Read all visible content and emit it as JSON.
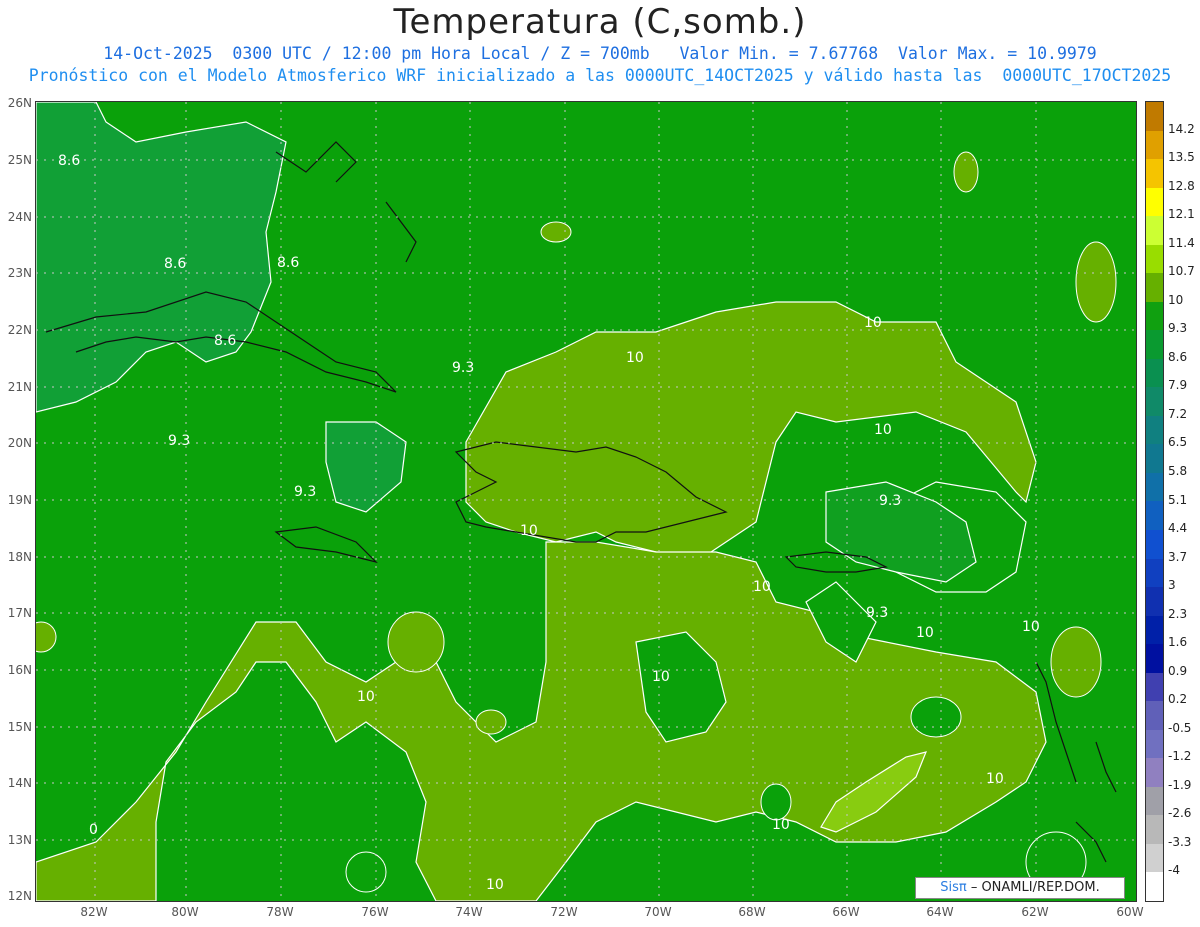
{
  "header": {
    "title": "Temperatura (C,somb.)",
    "line1": "14-Oct-2025  0300 UTC / 12:00 pm Hora Local / Z = 700mb   Valor Min. = 7.67768  Valor Max. = 10.9979",
    "line2": "Pronóstico con el Modelo Atmosferico WRF inicializado a las 0000UTC_14OCT2025 y válido hasta las  0000UTC_17OCT2025"
  },
  "axes": {
    "lat_labels": [
      "26N",
      "25N",
      "24N",
      "23N",
      "22N",
      "21N",
      "20N",
      "19N",
      "18N",
      "17N",
      "16N",
      "15N",
      "14N",
      "13N",
      "12N"
    ],
    "lon_labels": [
      "82W",
      "80W",
      "78W",
      "76W",
      "74W",
      "72W",
      "70W",
      "68W",
      "66W",
      "64W",
      "62W",
      "60W"
    ]
  },
  "contour_labels": [
    "8.6",
    "8.6",
    "8.6",
    "8.6",
    "9.3",
    "9.3",
    "9.3",
    "9.3",
    "9.3",
    "10",
    "10",
    "10",
    "10",
    "10",
    "10",
    "10",
    "10",
    "10",
    "10",
    "10",
    "10",
    "0"
  ],
  "colorbar": {
    "labels": [
      "14.2",
      "13.5",
      "12.8",
      "12.1",
      "11.4",
      "10.7",
      "10",
      "9.3",
      "8.6",
      "7.9",
      "7.2",
      "6.5",
      "5.8",
      "5.1",
      "4.4",
      "3.7",
      "3",
      "2.3",
      "1.6",
      "0.9",
      "0.2",
      "-0.5",
      "-1.2",
      "-1.9",
      "-2.6",
      "-3.3",
      "-4"
    ],
    "colors": [
      "#c07a00",
      "#e0a000",
      "#f5c400",
      "#ffff00",
      "#ccff33",
      "#99dd00",
      "#66b000",
      "#10a010",
      "#0a9a30",
      "#0a9050",
      "#108a68",
      "#108080",
      "#107890",
      "#1070a8",
      "#1060c0",
      "#1050d0",
      "#1040c0",
      "#1030b0",
      "#0020a8",
      "#0010a0",
      "#4040b0",
      "#6060b8",
      "#7070c0",
      "#9080c0",
      "#a0a0a8",
      "#b8b8b8",
      "#d0d0d0",
      "#ffffff"
    ]
  },
  "credit": {
    "brand": "Sisπ",
    "text": " – ONAMLI/REP.DOM."
  }
}
